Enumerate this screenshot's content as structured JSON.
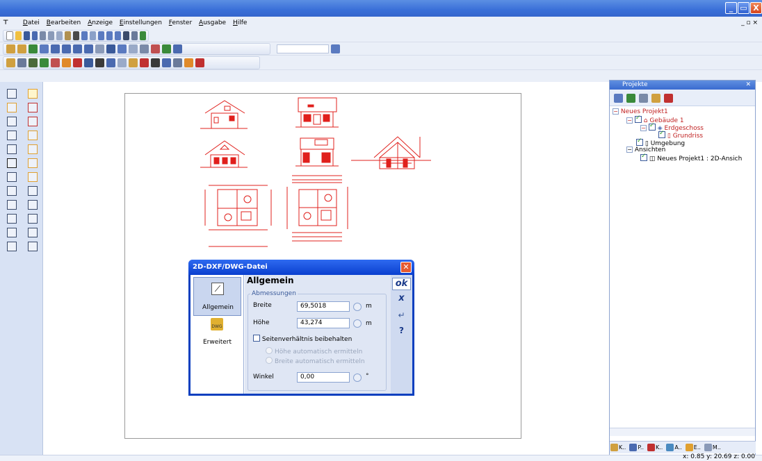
{
  "menu": [
    "Datei",
    "Bearbeiten",
    "Anzeige",
    "Einstellungen",
    "Fenster",
    "Ausgabe",
    "Hilfe"
  ],
  "window_controls": {
    "minimize": "_",
    "restore": "▭",
    "close": "X"
  },
  "doc_controls": "_ ▫ ×",
  "panel": {
    "title": "Projekte",
    "tree": {
      "project": "Neues Projekt1",
      "building": "Gebäude 1",
      "floor": "Erdgeschoss",
      "plan": "Grundriss",
      "env": "Umgebung",
      "views": "Ansichten",
      "view1": "Neues Projekt1 : 2D-Ansich"
    }
  },
  "bottom_tabs": [
    "K..",
    "P..",
    "K..",
    "A..",
    "E..",
    "M.."
  ],
  "status": "x: 0.85 y: 20.69 z: 0.00",
  "dialog": {
    "title": "2D-DXF/DWG-Datei",
    "nav1": "Allgemein",
    "nav2": "Erweitert",
    "section": "Allgemein",
    "group": "Abmessungen",
    "width_label": "Breite",
    "width_value": "69,5018",
    "width_unit": "m",
    "height_label": "Höhe",
    "height_value": "43,274",
    "height_unit": "m",
    "keep_ratio": "Seitenverhältnis beibehalten",
    "opt1": "Höhe automatisch ermitteln",
    "opt2": "Breite automatisch ermitteln",
    "angle_label": "Winkel",
    "angle_value": "0,00",
    "angle_unit": "°",
    "ok": "ok",
    "cancel": "x",
    "apply": "↵",
    "help": "?"
  },
  "colors": {
    "drawing": "#e0201c",
    "titlebar": "#3a6fd8",
    "selection": "#e0201c"
  }
}
